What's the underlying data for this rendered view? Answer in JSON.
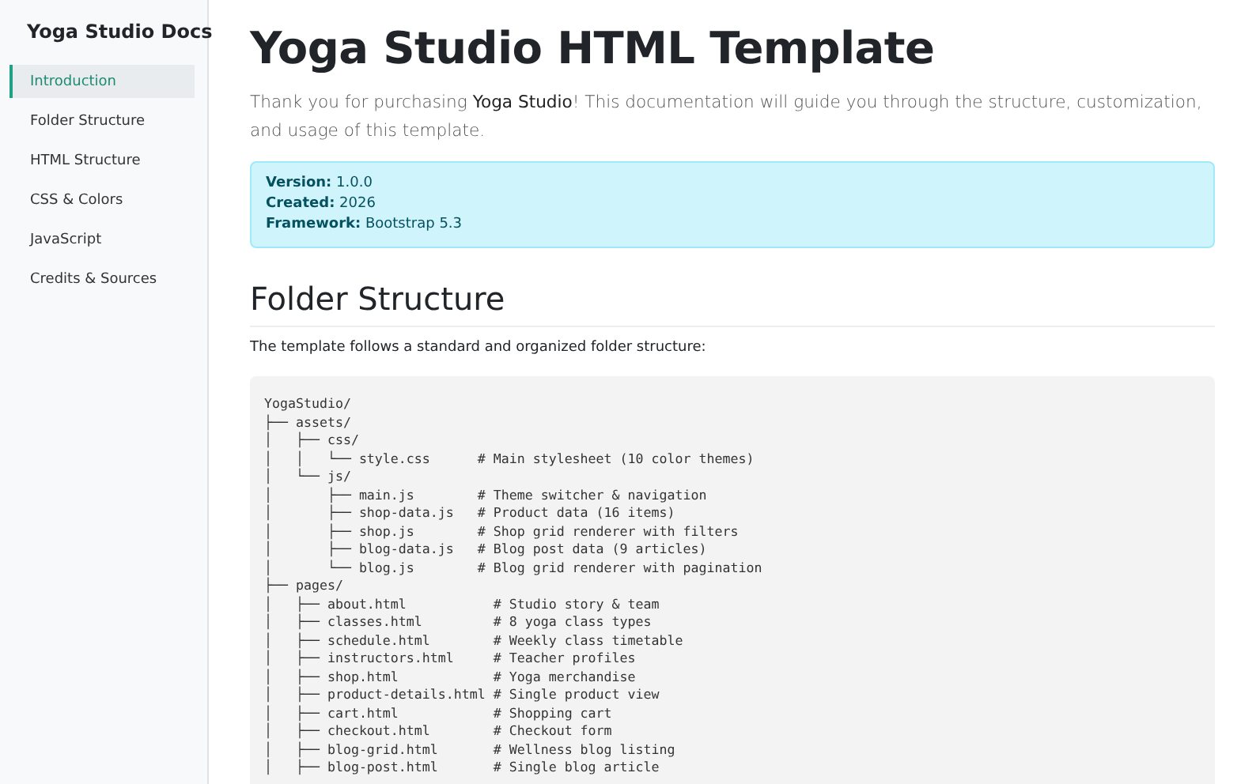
{
  "sidebar": {
    "title": "Yoga Studio Docs",
    "items": [
      {
        "label": "Introduction",
        "selected": true
      },
      {
        "label": "Folder Structure",
        "selected": false
      },
      {
        "label": "HTML Structure",
        "selected": false
      },
      {
        "label": "CSS & Colors",
        "selected": false
      },
      {
        "label": "JavaScript",
        "selected": false
      },
      {
        "label": "Credits & Sources",
        "selected": false
      }
    ]
  },
  "main": {
    "title": "Yoga Studio HTML Template",
    "lead": "Thank you for purchasing **Yoga Studio**! This documentation will guide you through the structure, customization, and usage of this template.",
    "info": [
      {
        "label": "Version:",
        "value": "1.0.0"
      },
      {
        "label": "Created:",
        "value": "2026"
      },
      {
        "label": "Framework:",
        "value": "Bootstrap 5.3"
      }
    ],
    "section": {
      "title": "Folder Structure",
      "text": "The template follows a standard and organized folder structure:",
      "code_lines": [
        "YogaStudio/",
        "├── assets/",
        "│   ├── css/",
        "│   │   └── style.css      # Main stylesheet (10 color themes)",
        "│   └── js/",
        "│       ├── main.js        # Theme switcher & navigation",
        "│       ├── shop-data.js   # Product data (16 items)",
        "│       ├── shop.js        # Shop grid renderer with filters",
        "│       ├── blog-data.js   # Blog post data (9 articles)",
        "│       └── blog.js        # Blog grid renderer with pagination",
        "├── pages/",
        "│   ├── about.html           # Studio story & team",
        "│   ├── classes.html         # 8 yoga class types",
        "│   ├── schedule.html        # Weekly class timetable",
        "│   ├── instructors.html     # Teacher profiles",
        "│   ├── shop.html            # Yoga merchandise",
        "│   ├── product-details.html # Single product view",
        "│   ├── cart.html            # Shopping cart",
        "│   ├── checkout.html        # Checkout form",
        "│   ├── blog-grid.html       # Wellness blog listing",
        "│   ├── blog-post.html       # Single blog article"
      ]
    }
  }
}
